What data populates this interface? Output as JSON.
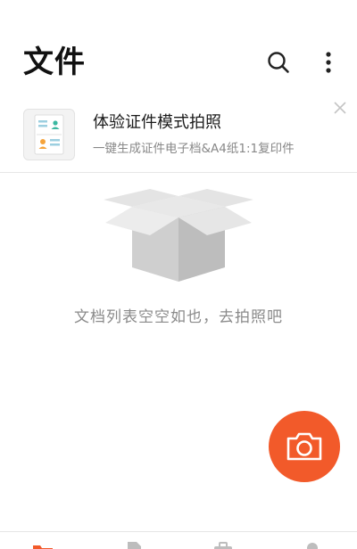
{
  "header": {
    "title": "文件"
  },
  "promo": {
    "title": "体验证件模式拍照",
    "subtitle": "一键生成证件电子档&A4纸1:1复印件"
  },
  "empty_state": {
    "message": "文档列表空空如也，去拍照吧"
  },
  "icons": {
    "search": "search-icon",
    "more": "more-vertical-icon",
    "close": "close-icon",
    "camera": "camera-icon",
    "empty_box": "open-box-illustration"
  },
  "colors": {
    "accent": "#f25a2a",
    "muted_text": "#8a8a8a",
    "card_teal": "#3bb8a0",
    "card_orange": "#f5a33a"
  },
  "bottom_nav": {
    "items": [
      {
        "icon": "folder-icon",
        "active": true
      },
      {
        "icon": "document-icon",
        "active": false
      },
      {
        "icon": "toolbox-icon",
        "active": false
      },
      {
        "icon": "profile-icon",
        "active": false
      }
    ]
  }
}
